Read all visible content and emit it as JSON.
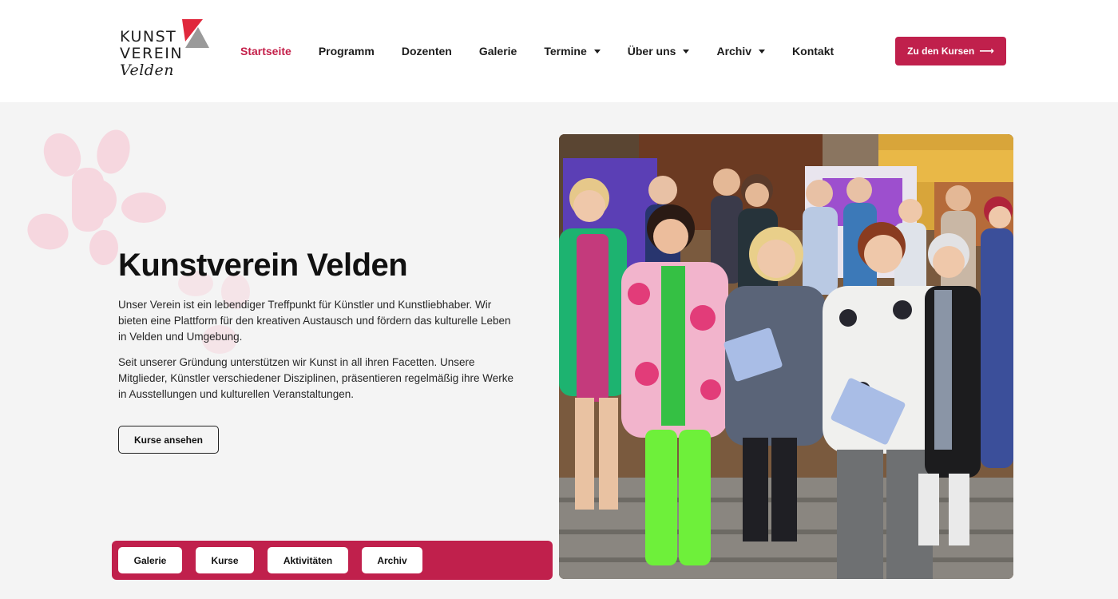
{
  "logo": {
    "line1": "KUNST",
    "line2": "VEREIN",
    "line3": "Velden",
    "colors": {
      "red": "#e0283c",
      "grey": "#9a9a9a"
    }
  },
  "nav": {
    "items": [
      {
        "label": "Startseite",
        "active": true,
        "dropdown": false
      },
      {
        "label": "Programm",
        "active": false,
        "dropdown": false
      },
      {
        "label": "Dozenten",
        "active": false,
        "dropdown": false
      },
      {
        "label": "Galerie",
        "active": false,
        "dropdown": false
      },
      {
        "label": "Termine",
        "active": false,
        "dropdown": true
      },
      {
        "label": "Über uns",
        "active": false,
        "dropdown": true
      },
      {
        "label": "Archiv",
        "active": false,
        "dropdown": true
      },
      {
        "label": "Kontakt",
        "active": false,
        "dropdown": false
      }
    ]
  },
  "cta": {
    "label": "Zu den Kursen",
    "icon": "arrow-right-icon"
  },
  "hero": {
    "title": "Kunstverein Velden",
    "p1": "Unser Verein ist ein lebendiger Treffpunkt für Künstler und Kunstliebhaber. Wir bieten eine Plattform für den kreativen Austausch und fördern das kulturelle Leben in Velden und Umgebung.",
    "p2": "Seit unserer Gründung unterstützen wir Kunst in all ihren Facetten. Unsere Mitglieder, Künstler verschiedener Disziplinen, präsentieren regelmäßig ihre Werke in Ausstellungen und kulturellen Veranstaltungen.",
    "button": "Kurse ansehen"
  },
  "tags": [
    "Galerie",
    "Kurse",
    "Aktivitäten",
    "Archiv"
  ],
  "colors": {
    "accent": "#c0204c",
    "active_nav": "#c4204a",
    "background": "#f4f4f4",
    "flower": "#f6d7df"
  }
}
